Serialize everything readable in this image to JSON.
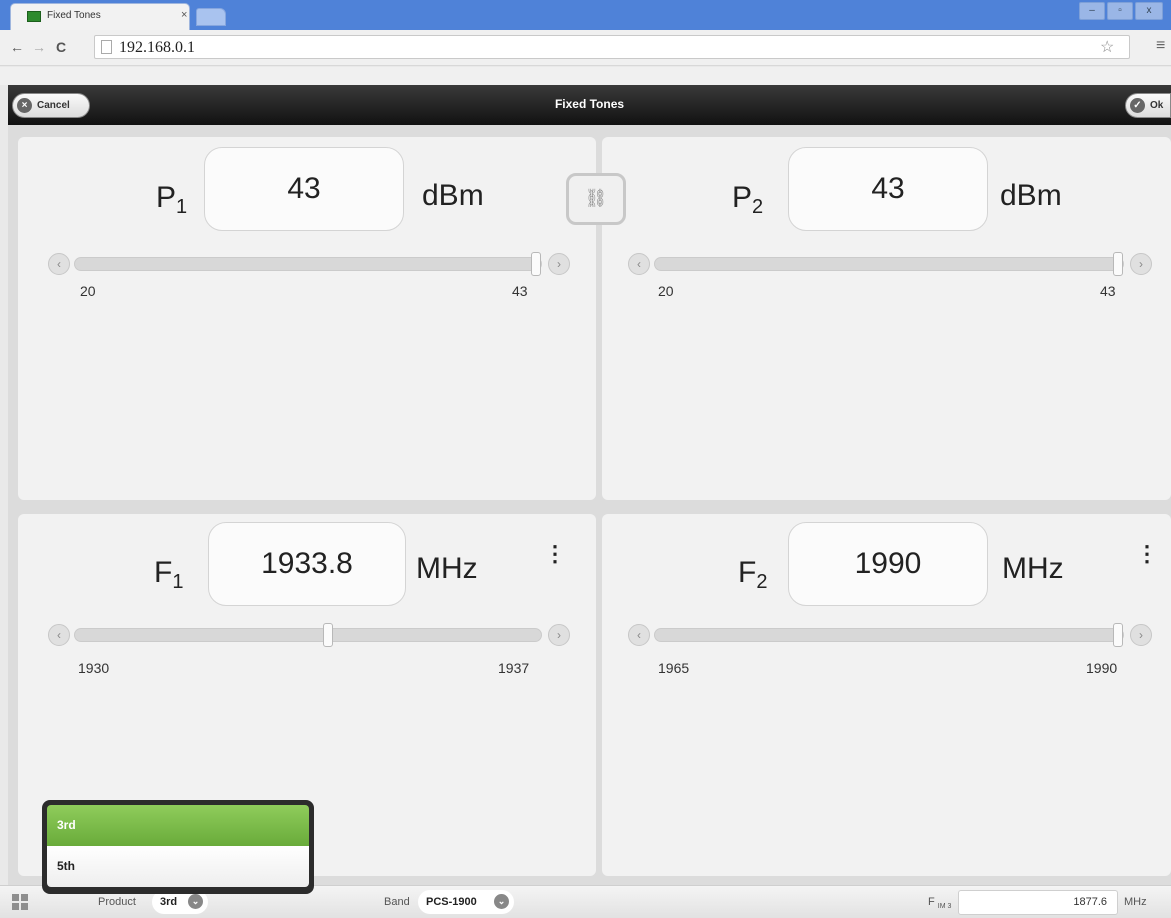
{
  "browser": {
    "tab_title": "Fixed Tones",
    "tab_close": "×",
    "url": "192.168.0.1",
    "back_glyph": "←",
    "forward_glyph": "→",
    "reload_glyph": "C",
    "star_glyph": "☆",
    "menu_glyph": "≡",
    "window_buttons": [
      "–",
      "▫",
      "x"
    ]
  },
  "header": {
    "title": "Fixed Tones",
    "cancel_label": "Cancel",
    "ok_label": "Ok",
    "cancel_icon": "×",
    "ok_icon": "✓"
  },
  "link_glyph": "⛓",
  "panels": {
    "p1": {
      "symbol": "P",
      "subscript": "1",
      "value": "43",
      "unit": "dBm",
      "min_label": "20",
      "max_label": "43",
      "slider_position": 1.0
    },
    "p2": {
      "symbol": "P",
      "subscript": "2",
      "value": "43",
      "unit": "dBm",
      "min_label": "20",
      "max_label": "43",
      "slider_position": 1.0
    },
    "f1": {
      "symbol": "F",
      "subscript": "1",
      "value": "1933.8",
      "unit": "MHz",
      "min_label": "1930",
      "max_label": "1937",
      "slider_position": 0.543
    },
    "f2": {
      "symbol": "F",
      "subscript": "2",
      "value": "1990",
      "unit": "MHz",
      "min_label": "1965",
      "max_label": "1990",
      "slider_position": 1.0
    }
  },
  "slider_arrows": {
    "left": "‹",
    "right": "›"
  },
  "more_glyph": "⋮",
  "footer": {
    "product_label": "Product",
    "product_value": "3rd",
    "band_label": "Band",
    "band_value": "PCS-1900",
    "fim_label": "F",
    "fim_sub": "IM 3",
    "fim_value": "1877.6",
    "fim_unit": "MHz",
    "chevron": "⌄"
  },
  "product_popup": {
    "options": [
      "3rd",
      "5th"
    ],
    "selected": "3rd"
  }
}
